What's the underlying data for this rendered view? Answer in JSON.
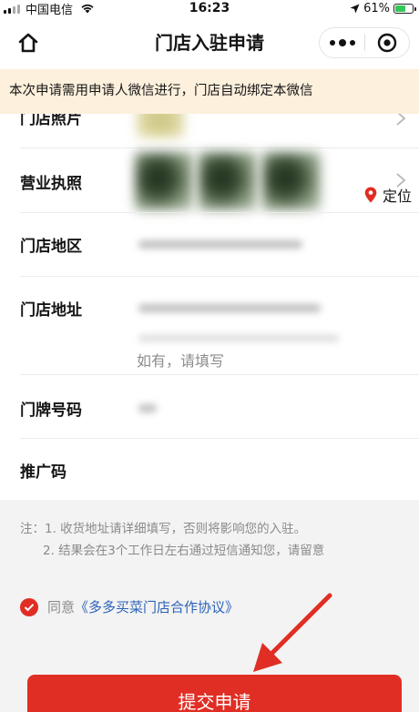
{
  "status_bar": {
    "carrier": "中国电信",
    "time": "16:23",
    "battery_percent": "61%",
    "battery_level": 0.61,
    "battery_color": "#34c759"
  },
  "nav": {
    "title": "门店入驻申请",
    "home_icon": "home-icon",
    "more_icon": "more-dots-icon",
    "close_icon": "target-close-icon"
  },
  "notice": {
    "text": "本次申请需用申请人微信进行，门店自动绑定本微信",
    "background": "#fdf0dc"
  },
  "form": {
    "fields": [
      {
        "label": "门店照片"
      },
      {
        "label": "营业执照"
      },
      {
        "label": "门店地区"
      },
      {
        "label": "门店地址"
      },
      {
        "label": "门牌号码"
      },
      {
        "label": "推广码"
      }
    ],
    "locate_label": "定位",
    "locate_icon": "location-pin-icon",
    "promo_placeholder": "如有，请填写"
  },
  "notes": {
    "line1": "注：1. 收货地址请详细填写，否则将影响您的入驻。",
    "line2": "2. 结果会在3个工作日左右通过短信通知您，请留意"
  },
  "agreement": {
    "prefix": "同意",
    "link": "《多多买菜门店合作协议》",
    "checked": true,
    "link_color": "#2a62b8"
  },
  "submit": {
    "label": "提交申请",
    "color": "#e02e24"
  },
  "annotation": {
    "arrow_color": "#e02e24"
  }
}
